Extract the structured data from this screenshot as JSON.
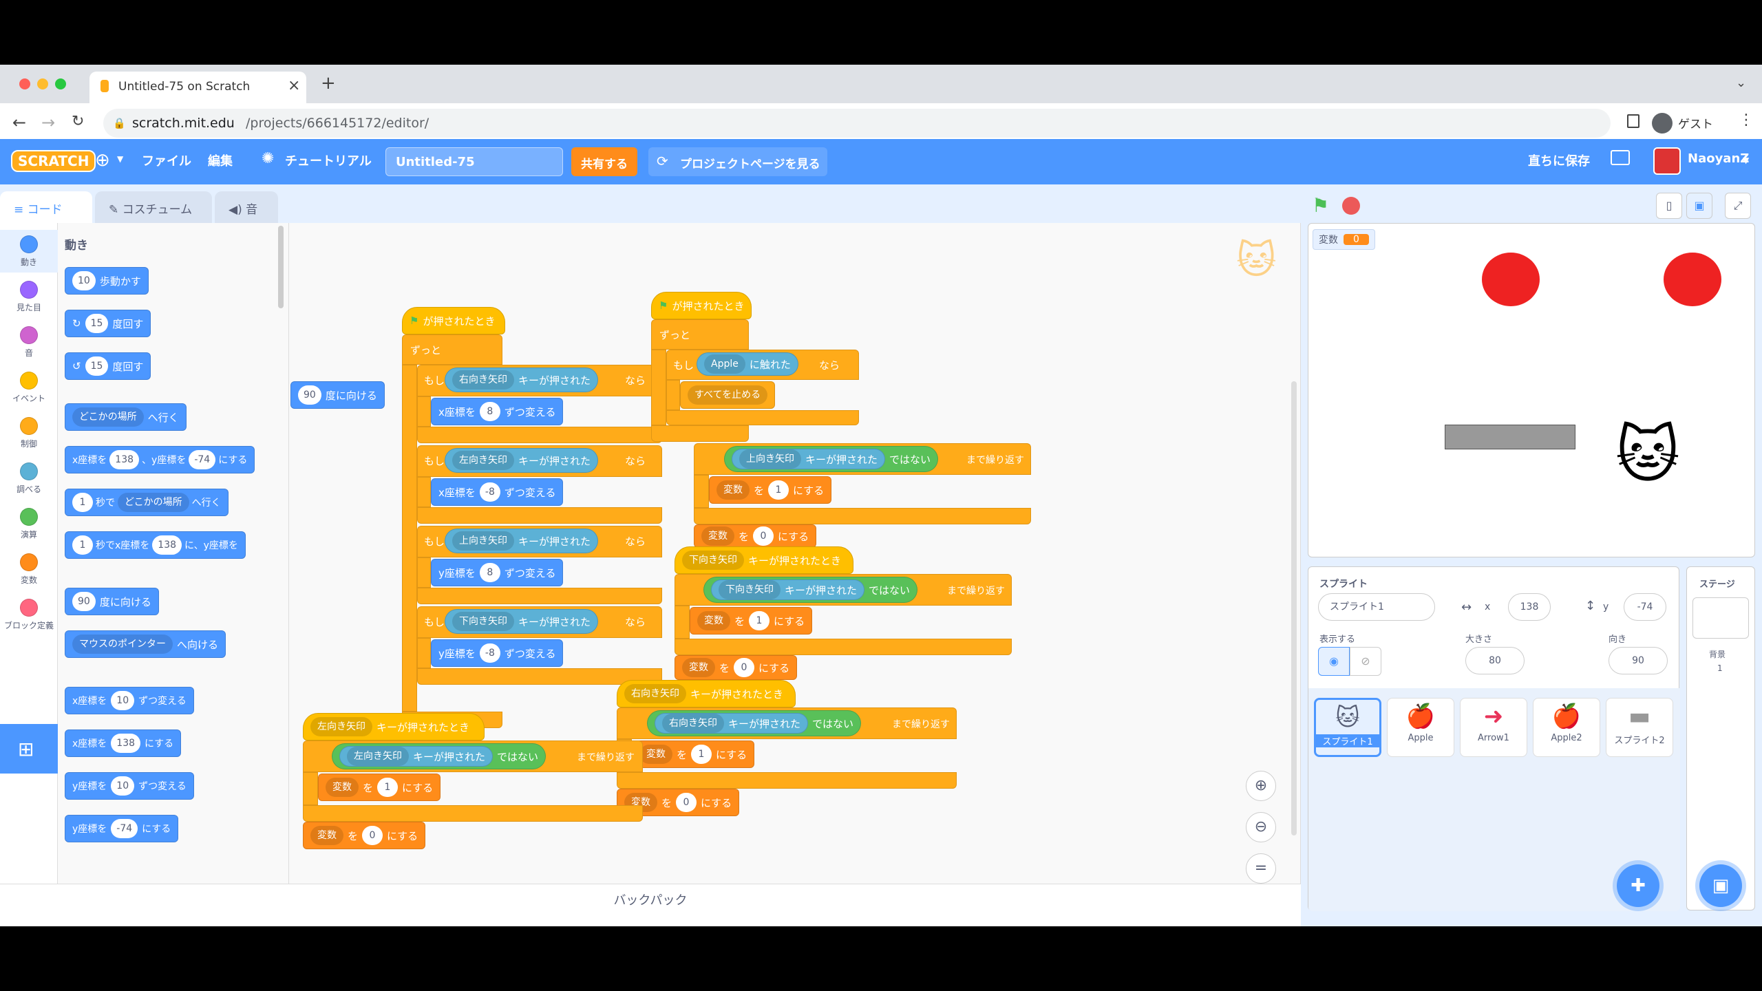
{
  "browser": {
    "tab_title": "Untitled-75 on Scratch",
    "url_domain": "scratch.mit.edu",
    "url_path": "/projects/666145172/editor/",
    "guest": "ゲスト",
    "tab_close": "×",
    "new_tab": "+"
  },
  "menu": {
    "logo": "SCRATCH",
    "file": "ファイル",
    "edit": "編集",
    "tutorial": "チュートリアル",
    "project_title": "Untitled-75",
    "share": "共有する",
    "see_project": "プロジェクトページを見る",
    "save_now": "直ちに保存",
    "user": "NaoyanZ"
  },
  "tabs": {
    "code": "コード",
    "costume": "コスチューム",
    "sound": "音"
  },
  "categories": [
    {
      "label": "動き",
      "color": "#4c97ff"
    },
    {
      "label": "見た目",
      "color": "#9966ff"
    },
    {
      "label": "音",
      "color": "#cf63cf"
    },
    {
      "label": "イベント",
      "color": "#ffbf00"
    },
    {
      "label": "制御",
      "color": "#ffab19"
    },
    {
      "label": "調べる",
      "color": "#5cb1d6"
    },
    {
      "label": "演算",
      "color": "#59c059"
    },
    {
      "label": "変数",
      "color": "#ff8c1a"
    },
    {
      "label": "ブロック定義",
      "color": "#ff6680"
    }
  ],
  "palette": {
    "heading": "動き",
    "b1": {
      "n": "10",
      "t": "歩動かす"
    },
    "b2": {
      "n": "15",
      "t": "度回す"
    },
    "b3": {
      "n": "15",
      "t": "度回す"
    },
    "b4": {
      "dd": "どこかの場所",
      "t": "へ行く"
    },
    "b5": {
      "a": "x座標を",
      "x": "138",
      "b": "、y座標を",
      "y": "-74",
      "c": "にする"
    },
    "b6": {
      "n": "1",
      "a": "秒で",
      "dd": "どこかの場所",
      "t": "へ行く"
    },
    "b7": {
      "n": "1",
      "a": "秒でx座標を",
      "x": "138",
      "b": "に、y座標を"
    },
    "b8": {
      "n": "90",
      "t": "度に向ける"
    },
    "b9": {
      "dd": "マウスのポインター",
      "t": "へ向ける"
    },
    "b10": {
      "a": "x座標を",
      "n": "10",
      "t": "ずつ変える"
    },
    "b11": {
      "a": "x座標を",
      "n": "138",
      "t": "にする"
    },
    "b12": {
      "a": "y座標を",
      "n": "10",
      "t": "ずつ変える"
    },
    "b13": {
      "a": "y座標を",
      "n": "-74",
      "t": "にする"
    }
  },
  "script": {
    "when_flag": "が押されたとき",
    "forever": "ずっと",
    "if": "もし",
    "then": "なら",
    "key_pressed": "キーが押された",
    "key_when": "キーが押されたとき",
    "not": "ではない",
    "repeat_until": "まで繰り返す",
    "change_by": "ずつ変える",
    "set_to": "にする",
    "wo": "を",
    "x_label": "x座標を",
    "y_label": "y座標を",
    "right": "右向き矢印",
    "left": "左向き矢印",
    "up": "上向き矢印",
    "down": "下向き矢印",
    "var": "変数",
    "apple": "Apple",
    "touching": "に触れた",
    "stop_all": "すべてを止める",
    "point_dir": "度に向ける",
    "n90": "90",
    "n8": "8",
    "nm8": "-8",
    "n1": "1",
    "n0": "0"
  },
  "backpack": "バックパック",
  "stage": {
    "var_name": "変数",
    "var_value": "0"
  },
  "sprite_info": {
    "sprite_label": "スプライト",
    "sprite_name": "スプライト1",
    "x_label": "x",
    "x": "138",
    "y_label": "y",
    "y": "-74",
    "show_label": "表示する",
    "size_label": "大きさ",
    "size": "80",
    "dir_label": "向き",
    "dir": "90"
  },
  "stage_panel": {
    "title": "ステージ",
    "backdrop_label": "背景",
    "backdrop_count": "1"
  },
  "sprites": [
    "スプライト1",
    "Apple",
    "Arrow1",
    "Apple2",
    "スプライト2"
  ]
}
